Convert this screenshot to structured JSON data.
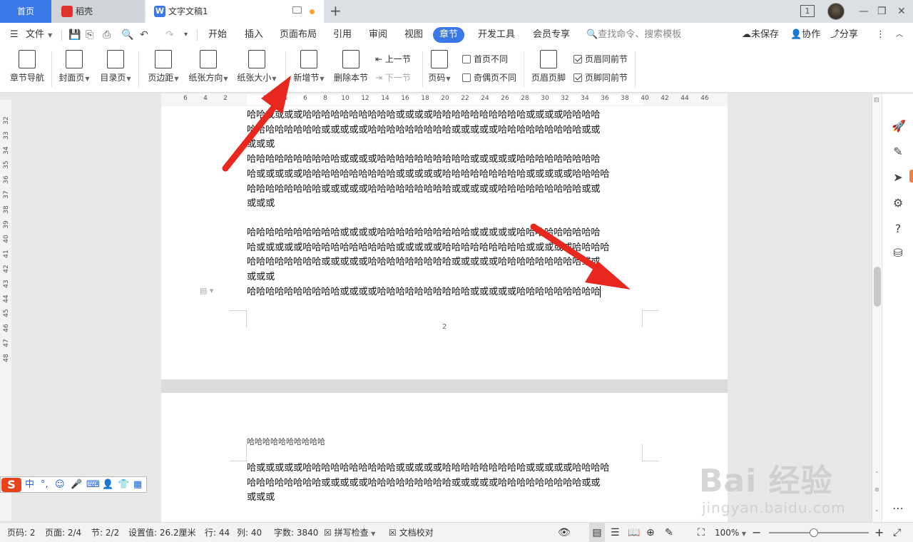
{
  "titlebar": {
    "home_tab": "首页",
    "daoke_tab": "稻壳",
    "doc_tab": "文字文稿1",
    "doc_logo": "W",
    "window_count": "1",
    "add_tab": "+",
    "minimize": "—",
    "restore": "❐",
    "close": "✕"
  },
  "menubar": {
    "file": "文件",
    "items": [
      "开始",
      "插入",
      "页面布局",
      "引用",
      "审阅",
      "视图",
      "章节",
      "开发工具",
      "会员专享"
    ],
    "active": "章节",
    "search_placeholder": "查找命令、搜索模板",
    "unsaved": "未保存",
    "collab": "协作",
    "share": "分享"
  },
  "ribbon": {
    "chapter_nav": "章节导航",
    "cover_page": "封面页",
    "toc_page": "目录页",
    "margins": "页边距",
    "orientation": "纸张方向",
    "paper_size": "纸张大小",
    "new_section": "新增节",
    "delete_section": "删除本节",
    "prev_section": "上一节",
    "next_section": "下一节",
    "page_number": "页码",
    "first_page_diff": "首页不同",
    "odd_even_diff": "奇偶页不同",
    "header_footer": "页眉页脚",
    "header_same_prev": "页眉同前节",
    "footer_same_prev": "页脚同前节",
    "header_same_prev_checked": true,
    "footer_same_prev_checked": true
  },
  "ruler": {
    "h_ticks": [
      "6",
      "4",
      "2",
      "2",
      "4",
      "6",
      "8",
      "10",
      "12",
      "14",
      "16",
      "18",
      "20",
      "22",
      "24",
      "26",
      "28",
      "30",
      "32",
      "34",
      "36",
      "38",
      "40",
      "42",
      "44",
      "46"
    ],
    "v_ticks": [
      "32",
      "33",
      "34",
      "35",
      "36",
      "37",
      "38",
      "39",
      "40",
      "41",
      "42",
      "43",
      "44",
      "45",
      "46",
      "47",
      "48"
    ]
  },
  "document": {
    "page1_lines_a": [
      "哈哈或或或或哈哈哈哈哈哈哈哈哈哈或或或或哈哈哈哈哈哈哈哈哈哈或或或或哈哈哈哈",
      "哈哈哈哈哈哈哈哈或或或或或哈哈哈哈哈哈哈哈哈或或或或或哈哈哈哈哈哈哈哈哈或或",
      "或或或",
      "哈哈哈哈哈哈哈哈哈哈或或或或哈哈哈哈哈哈哈哈哈哈或或或或或哈哈哈哈哈哈哈哈哈",
      "哈或或或或或哈哈哈哈哈哈哈哈哈哈或或或或或哈哈哈哈哈哈哈哈哈或或或或或哈哈哈哈",
      "哈哈哈哈哈哈哈哈或或或或或哈哈哈哈哈哈哈哈哈或或或或或哈哈哈哈哈哈哈哈哈或或",
      "或或或"
    ],
    "page1_lines_b": [
      "哈哈哈哈哈哈哈哈哈哈或或或或哈哈哈哈哈哈哈哈哈哈或或或或或哈哈哈哈哈哈哈哈哈",
      "哈或或或或或哈哈哈哈哈哈哈哈哈哈或或或或或哈哈哈哈哈哈哈哈哈或或或或或哈哈哈哈",
      "哈哈哈哈哈哈哈哈或或或或或哈哈哈哈哈哈哈哈哈或或或或或哈哈哈哈哈哈哈哈哈或或",
      "或或或",
      "哈哈哈哈哈哈哈哈哈哈或或或或哈哈哈哈哈哈哈哈哈哈或或或或或哈哈哈哈哈哈哈哈哈"
    ],
    "page1_number": "2",
    "page2_header": "哈哈哈哈哈哈哈哈哈哈",
    "page2_lines": [
      "哈或或或或或哈哈哈哈哈哈哈哈哈哈或或或或或哈哈哈哈哈哈哈哈哈或或或或或哈哈哈哈",
      "哈哈哈哈哈哈哈哈或或或或或哈哈哈哈哈哈哈哈哈或或或或或哈哈哈哈哈哈哈哈哈或或",
      "或或或"
    ]
  },
  "statusbar": {
    "page_num": "页码: 2",
    "page_of": "页面: 2/4",
    "section": "节: 2/2",
    "setting": "设置值: 26.2厘米",
    "row": "行: 44",
    "col": "列: 40",
    "word_count": "字数: 3840",
    "spell_check": "拼写检查",
    "doc_proof": "文档校对",
    "zoom": "100%",
    "zoom_fraction": 0.45
  },
  "ime": {
    "logo": "S",
    "mode": "中"
  },
  "watermark": {
    "brand": "Bai 经验",
    "url": "jingyan.baidu.com"
  },
  "colors": {
    "accent": "#3b78e7",
    "arrow": "#e8281e",
    "titlebar": "#dcdfe4"
  }
}
